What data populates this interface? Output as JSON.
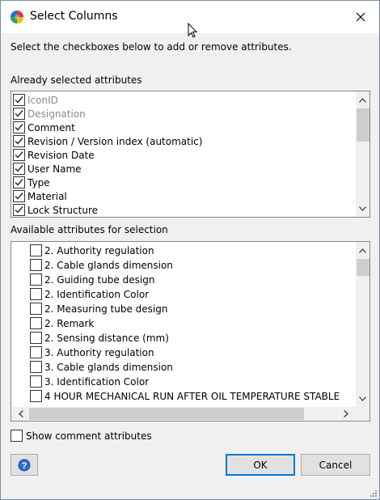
{
  "window": {
    "title": "Select Columns"
  },
  "instructions": "Select the checkboxes below to add or remove attributes.",
  "selected_section": {
    "label": "Already selected attributes",
    "items": [
      {
        "label": "IconID",
        "checked": true,
        "disabled": true
      },
      {
        "label": "Designation",
        "checked": true,
        "disabled": true
      },
      {
        "label": "Comment",
        "checked": true,
        "disabled": false
      },
      {
        "label": "Revision / Version index (automatic)",
        "checked": true,
        "disabled": false
      },
      {
        "label": "Revision Date",
        "checked": true,
        "disabled": false
      },
      {
        "label": "User Name",
        "checked": true,
        "disabled": false
      },
      {
        "label": "Type",
        "checked": true,
        "disabled": false
      },
      {
        "label": "Material",
        "checked": true,
        "disabled": false
      },
      {
        "label": "Lock Structure",
        "checked": true,
        "disabled": false
      }
    ]
  },
  "available_section": {
    "label": "Available attributes for selection",
    "items": [
      {
        "label": "2. Authority regulation",
        "checked": false
      },
      {
        "label": "2. Cable glands dimension",
        "checked": false
      },
      {
        "label": "2. Guiding tube design",
        "checked": false
      },
      {
        "label": "2. Identification Color",
        "checked": false
      },
      {
        "label": "2. Measuring tube design",
        "checked": false
      },
      {
        "label": "2. Remark",
        "checked": false
      },
      {
        "label": "2. Sensing distance (mm)",
        "checked": false
      },
      {
        "label": "3. Authority regulation",
        "checked": false
      },
      {
        "label": "3. Cable glands dimension",
        "checked": false
      },
      {
        "label": "3. Identification Color",
        "checked": false
      },
      {
        "label": "4 HOUR MECHANICAL RUN AFTER OIL TEMPERATURE STABLE",
        "checked": false
      }
    ]
  },
  "show_comment": {
    "label": "Show comment attributes",
    "checked": false
  },
  "buttons": {
    "ok": "OK",
    "cancel": "Cancel"
  },
  "icons": {
    "app": "app-logo-icon",
    "close": "close-icon",
    "help": "help-icon",
    "check": "checkmark-icon"
  }
}
